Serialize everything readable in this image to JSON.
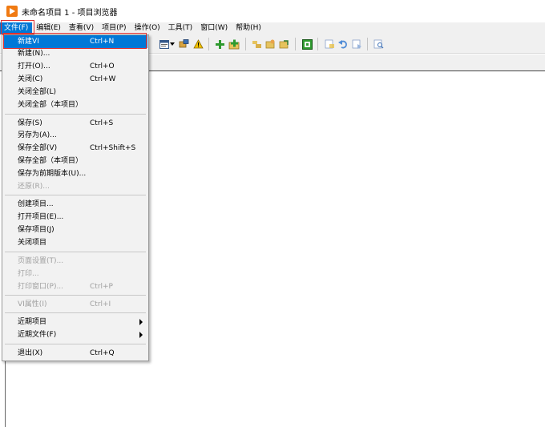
{
  "window": {
    "title": "未命名项目 1 - 项目浏览器"
  },
  "menubar": {
    "items": [
      {
        "label": "文件(F)"
      },
      {
        "label": "编辑(E)"
      },
      {
        "label": "查看(V)"
      },
      {
        "label": "项目(P)"
      },
      {
        "label": "操作(O)"
      },
      {
        "label": "工具(T)"
      },
      {
        "label": "窗口(W)"
      },
      {
        "label": "帮助(H)"
      }
    ]
  },
  "file_menu": {
    "items": [
      {
        "label": "新建VI",
        "shortcut": "Ctrl+N"
      },
      {
        "label": "新建(N)...",
        "shortcut": ""
      },
      {
        "label": "打开(O)...",
        "shortcut": "Ctrl+O"
      },
      {
        "label": "关闭(C)",
        "shortcut": "Ctrl+W"
      },
      {
        "label": "关闭全部(L)",
        "shortcut": ""
      },
      {
        "label": "关闭全部（本项目）",
        "shortcut": ""
      },
      {
        "label": "保存(S)",
        "shortcut": "Ctrl+S"
      },
      {
        "label": "另存为(A)...",
        "shortcut": ""
      },
      {
        "label": "保存全部(V)",
        "shortcut": "Ctrl+Shift+S"
      },
      {
        "label": "保存全部（本项目）",
        "shortcut": ""
      },
      {
        "label": "保存为前期版本(U)...",
        "shortcut": ""
      },
      {
        "label": "还原(R)...",
        "shortcut": ""
      },
      {
        "label": "创建项目...",
        "shortcut": ""
      },
      {
        "label": "打开项目(E)...",
        "shortcut": ""
      },
      {
        "label": "保存项目(J)",
        "shortcut": ""
      },
      {
        "label": "关闭项目",
        "shortcut": ""
      },
      {
        "label": "页面设置(T)...",
        "shortcut": ""
      },
      {
        "label": "打印...",
        "shortcut": ""
      },
      {
        "label": "打印窗口(P)...",
        "shortcut": "Ctrl+P"
      },
      {
        "label": "VI属性(I)",
        "shortcut": "Ctrl+I"
      },
      {
        "label": "近期项目",
        "shortcut": ""
      },
      {
        "label": "近期文件(F)",
        "shortcut": ""
      },
      {
        "label": "退出(X)",
        "shortcut": "Ctrl+Q"
      }
    ]
  },
  "toolbar": {
    "icons": [
      "window-list-icon",
      "dropdown-arrow-icon",
      "properties-icon",
      "warning-icon",
      "add-item-icon",
      "add-folder-icon",
      "sort-icon",
      "expand-icon",
      "collapse-icon",
      "build-icon",
      "view-icon",
      "undo-icon",
      "redo-icon",
      "search-icon"
    ]
  }
}
